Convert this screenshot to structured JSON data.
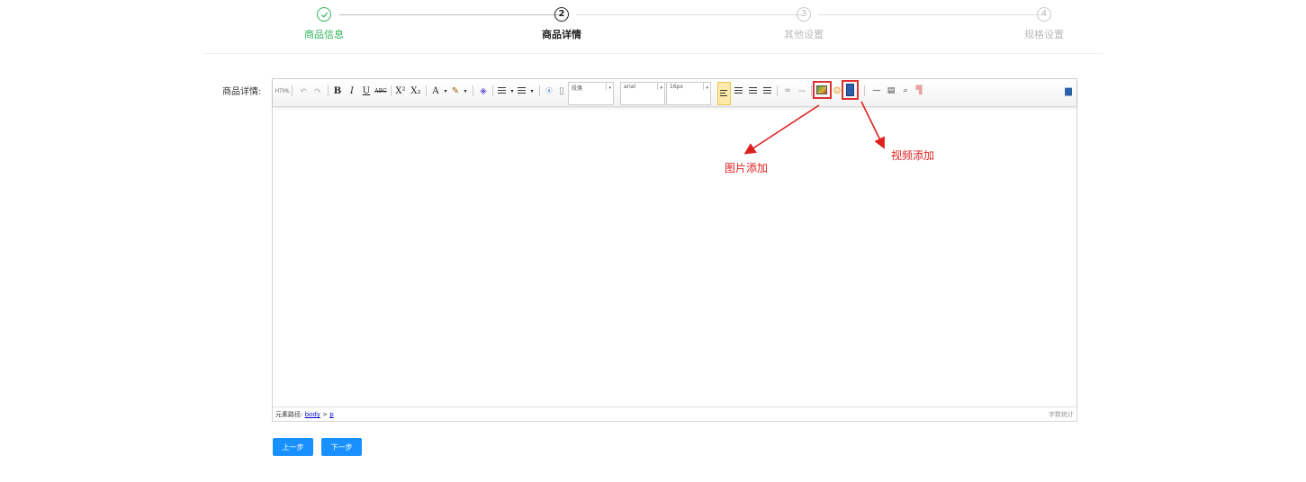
{
  "steps": [
    {
      "label": "商品信息",
      "icon": "check",
      "state": "done"
    },
    {
      "label": "商品详情",
      "number": "2",
      "state": "current"
    },
    {
      "label": "其他设置",
      "number": "3",
      "state": "pending"
    },
    {
      "label": "规格设置",
      "number": "4",
      "state": "pending"
    }
  ],
  "form": {
    "detail_label": "商品详情:"
  },
  "toolbar": {
    "source_label": "HTML",
    "bold": "B",
    "italic": "I",
    "underline": "U",
    "strike": "ABC",
    "superscript": "X²",
    "subscript": "X₂",
    "font_color": "A",
    "paragraph": "段落",
    "font_family": "arial",
    "font_size": "16px"
  },
  "status": {
    "path_label": "元素路径:",
    "path_body": "body",
    "path_sep": ">",
    "path_p": "p",
    "word_count": "字数统计"
  },
  "annotations": {
    "image_add": "图片添加",
    "video_add": "视频添加"
  },
  "buttons": {
    "prev": "上一步",
    "next": "下一步"
  },
  "colors": {
    "primary": "#1890ff",
    "success": "#2fb35a",
    "annotation": "#e02020"
  }
}
